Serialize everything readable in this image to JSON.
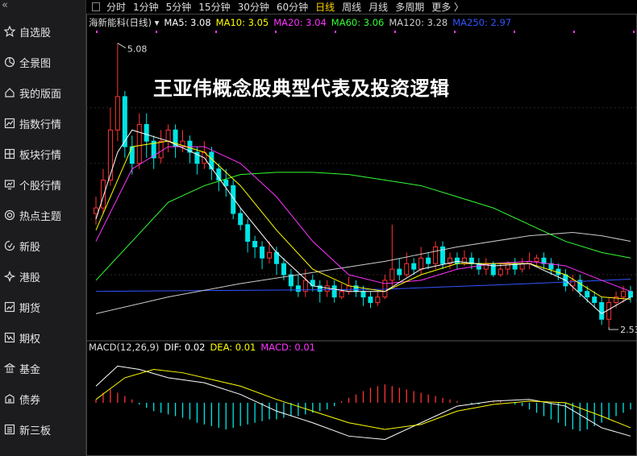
{
  "sidebar": {
    "collapse_glyph": "«",
    "items": [
      {
        "label": "自选股",
        "icon": "star-icon"
      },
      {
        "label": "全景图",
        "icon": "pie-icon"
      },
      {
        "label": "我的版面",
        "icon": "home-icon"
      },
      {
        "label": "指数行情",
        "icon": "chart-icon"
      },
      {
        "label": "板块行情",
        "icon": "blocks-icon"
      },
      {
        "label": "个股行情",
        "icon": "monitor-icon"
      },
      {
        "label": "热点主题",
        "icon": "target-icon"
      },
      {
        "label": "新股",
        "icon": "new-icon"
      },
      {
        "label": "港股",
        "icon": "hk-icon"
      },
      {
        "label": "期货",
        "icon": "futures-icon"
      },
      {
        "label": "期权",
        "icon": "options-icon"
      },
      {
        "label": "基金",
        "icon": "fund-icon"
      },
      {
        "label": "债券",
        "icon": "bond-icon"
      },
      {
        "label": "新三板",
        "icon": "nse-icon"
      }
    ]
  },
  "timeframes": [
    "分时",
    "1分钟",
    "5分钟",
    "15分钟",
    "30分钟",
    "60分钟",
    "日线",
    "周线",
    "月线",
    "多周期",
    "更多 〉"
  ],
  "active_timeframe": "日线",
  "ma_legend": [
    {
      "text": "海新能科(日线) ▾",
      "color": "#dddddd"
    },
    {
      "text": "MA5: 3.08",
      "color": "#ffffff"
    },
    {
      "text": "MA10: 3.05",
      "color": "#ffff00"
    },
    {
      "text": "MA20: 3.04",
      "color": "#ff33ff"
    },
    {
      "text": "MA60: 3.06",
      "color": "#33ff33"
    },
    {
      "text": "MA120: 3.28",
      "color": "#cccccc"
    },
    {
      "text": "MA250: 2.97",
      "color": "#3355ff"
    }
  ],
  "macd_legend": [
    {
      "text": "MACD(12,26,9)",
      "color": "#dddddd"
    },
    {
      "text": "DIF: 0.02",
      "color": "#ffffff"
    },
    {
      "text": "DEA: 0.01",
      "color": "#ffff00"
    },
    {
      "text": "MACD: 0.01",
      "color": "#ff33ff"
    }
  ],
  "headline": "王亚伟概念股典型代表及投资逻辑",
  "colors": {
    "up": "#ff3333",
    "down": "#00e5e5",
    "ma5": "#ffffff",
    "ma10": "#ffff00",
    "ma20": "#ff33ff",
    "ma60": "#33ff33",
    "ma120": "#cccccc",
    "ma250": "#3355ff"
  },
  "chart_data": {
    "type": "candlestick",
    "high_label": "5.08",
    "low_label": "2.53",
    "price_range": [
      2.45,
      5.2
    ],
    "candles": [
      [
        3.55,
        3.6,
        3.45,
        3.7
      ],
      [
        3.6,
        3.85,
        3.55,
        3.95
      ],
      [
        3.85,
        4.3,
        3.8,
        4.5
      ],
      [
        4.3,
        4.6,
        4.2,
        5.08
      ],
      [
        4.6,
        4.15,
        4.05,
        4.65
      ],
      [
        4.15,
        4.0,
        3.9,
        4.25
      ],
      [
        4.0,
        4.35,
        3.95,
        4.45
      ],
      [
        4.35,
        4.2,
        4.05,
        4.45
      ],
      [
        4.2,
        4.05,
        3.95,
        4.25
      ],
      [
        4.05,
        4.2,
        4.0,
        4.3
      ],
      [
        4.2,
        4.3,
        4.1,
        4.35
      ],
      [
        4.3,
        4.15,
        4.05,
        4.35
      ],
      [
        4.15,
        4.2,
        4.1,
        4.3
      ],
      [
        4.2,
        4.1,
        4.0,
        4.25
      ],
      [
        4.1,
        4.0,
        3.9,
        4.15
      ],
      [
        4.0,
        4.1,
        3.95,
        4.2
      ],
      [
        4.1,
        3.95,
        3.85,
        4.15
      ],
      [
        3.95,
        3.85,
        3.75,
        4.0
      ],
      [
        3.85,
        3.8,
        3.7,
        3.95
      ],
      [
        3.8,
        3.55,
        3.5,
        3.85
      ],
      [
        3.55,
        3.45,
        3.4,
        3.6
      ],
      [
        3.45,
        3.3,
        3.2,
        3.5
      ],
      [
        3.3,
        3.25,
        3.15,
        3.35
      ],
      [
        3.25,
        3.15,
        3.05,
        3.3
      ],
      [
        3.15,
        3.2,
        3.1,
        3.3
      ],
      [
        3.2,
        3.1,
        3.0,
        3.25
      ],
      [
        3.1,
        3.0,
        2.95,
        3.15
      ],
      [
        3.0,
        2.9,
        2.85,
        3.05
      ],
      [
        2.9,
        2.85,
        2.8,
        3.0
      ],
      [
        2.85,
        2.95,
        2.8,
        3.05
      ],
      [
        2.95,
        2.9,
        2.85,
        3.0
      ],
      [
        2.9,
        2.85,
        2.75,
        2.95
      ],
      [
        2.85,
        2.9,
        2.8,
        2.95
      ],
      [
        2.9,
        2.8,
        2.75,
        2.95
      ],
      [
        2.8,
        2.85,
        2.78,
        2.92
      ],
      [
        2.85,
        2.9,
        2.82,
        2.98
      ],
      [
        2.9,
        2.85,
        2.8,
        2.95
      ],
      [
        2.85,
        2.8,
        2.72,
        2.9
      ],
      [
        2.8,
        2.75,
        2.7,
        2.85
      ],
      [
        2.75,
        2.8,
        2.72,
        2.85
      ],
      [
        2.8,
        2.95,
        2.78,
        3.0
      ],
      [
        2.95,
        3.05,
        2.9,
        3.45
      ],
      [
        3.05,
        3.0,
        2.95,
        3.15
      ],
      [
        3.0,
        3.1,
        2.98,
        3.2
      ],
      [
        3.1,
        3.05,
        3.0,
        3.15
      ],
      [
        3.05,
        3.15,
        3.0,
        3.25
      ],
      [
        3.15,
        3.1,
        3.05,
        3.2
      ],
      [
        3.1,
        3.25,
        3.05,
        3.3
      ],
      [
        3.25,
        3.1,
        3.05,
        3.3
      ],
      [
        3.1,
        3.15,
        3.05,
        3.2
      ],
      [
        3.15,
        3.1,
        3.05,
        3.2
      ],
      [
        3.1,
        3.15,
        3.08,
        3.22
      ],
      [
        3.15,
        3.1,
        3.05,
        3.2
      ],
      [
        3.1,
        3.05,
        3.0,
        3.15
      ],
      [
        3.05,
        3.1,
        3.0,
        3.15
      ],
      [
        3.1,
        3.0,
        2.98,
        3.12
      ],
      [
        3.0,
        3.05,
        2.98,
        3.1
      ],
      [
        3.05,
        3.1,
        3.0,
        3.12
      ],
      [
        3.1,
        3.05,
        3.0,
        3.15
      ],
      [
        3.05,
        3.1,
        3.02,
        3.15
      ],
      [
        3.1,
        3.12,
        3.05,
        3.2
      ],
      [
        3.12,
        3.15,
        3.08,
        3.18
      ],
      [
        3.15,
        3.1,
        3.05,
        3.2
      ],
      [
        3.1,
        3.05,
        3.0,
        3.15
      ],
      [
        3.05,
        3.0,
        2.95,
        3.1
      ],
      [
        3.0,
        2.9,
        2.85,
        3.05
      ],
      [
        2.9,
        2.95,
        2.85,
        3.0
      ],
      [
        2.95,
        2.85,
        2.8,
        3.0
      ],
      [
        2.85,
        2.8,
        2.75,
        2.9
      ],
      [
        2.8,
        2.75,
        2.7,
        2.85
      ],
      [
        2.75,
        2.6,
        2.55,
        2.8
      ],
      [
        2.6,
        2.75,
        2.53,
        2.8
      ],
      [
        2.75,
        2.8,
        2.7,
        2.85
      ],
      [
        2.8,
        2.85,
        2.75,
        2.9
      ],
      [
        2.85,
        2.8,
        2.75,
        2.9
      ]
    ],
    "ma_series": {
      "ma5": [
        [
          0,
          3.5
        ],
        [
          3,
          4.1
        ],
        [
          5,
          4.3
        ],
        [
          10,
          4.2
        ],
        [
          15,
          4.05
        ],
        [
          20,
          3.6
        ],
        [
          25,
          3.2
        ],
        [
          30,
          2.9
        ],
        [
          35,
          2.85
        ],
        [
          40,
          2.85
        ],
        [
          45,
          3.05
        ],
        [
          50,
          3.12
        ],
        [
          55,
          3.08
        ],
        [
          60,
          3.1
        ],
        [
          65,
          2.95
        ],
        [
          70,
          2.65
        ],
        [
          74,
          2.8
        ]
      ],
      "ma10": [
        [
          0,
          3.4
        ],
        [
          5,
          4.15
        ],
        [
          10,
          4.2
        ],
        [
          15,
          4.1
        ],
        [
          20,
          3.8
        ],
        [
          25,
          3.4
        ],
        [
          30,
          3.05
        ],
        [
          35,
          2.9
        ],
        [
          40,
          2.85
        ],
        [
          45,
          3.0
        ],
        [
          50,
          3.1
        ],
        [
          55,
          3.1
        ],
        [
          60,
          3.1
        ],
        [
          65,
          3.0
        ],
        [
          70,
          2.8
        ],
        [
          74,
          2.78
        ]
      ],
      "ma20": [
        [
          0,
          3.3
        ],
        [
          5,
          3.95
        ],
        [
          10,
          4.15
        ],
        [
          15,
          4.15
        ],
        [
          20,
          4.0
        ],
        [
          25,
          3.7
        ],
        [
          30,
          3.3
        ],
        [
          35,
          3.0
        ],
        [
          40,
          2.92
        ],
        [
          45,
          2.95
        ],
        [
          50,
          3.05
        ],
        [
          55,
          3.1
        ],
        [
          60,
          3.12
        ],
        [
          65,
          3.08
        ],
        [
          70,
          2.95
        ],
        [
          74,
          2.85
        ]
      ],
      "ma60": [
        [
          0,
          2.95
        ],
        [
          5,
          3.3
        ],
        [
          10,
          3.65
        ],
        [
          15,
          3.8
        ],
        [
          20,
          3.9
        ],
        [
          25,
          3.92
        ],
        [
          30,
          3.92
        ],
        [
          35,
          3.9
        ],
        [
          40,
          3.85
        ],
        [
          45,
          3.8
        ],
        [
          50,
          3.7
        ],
        [
          55,
          3.6
        ],
        [
          60,
          3.45
        ],
        [
          65,
          3.3
        ],
        [
          70,
          3.2
        ],
        [
          74,
          3.15
        ]
      ],
      "ma120": [
        [
          0,
          2.65
        ],
        [
          10,
          2.8
        ],
        [
          20,
          2.92
        ],
        [
          30,
          3.02
        ],
        [
          40,
          3.12
        ],
        [
          50,
          3.25
        ],
        [
          60,
          3.35
        ],
        [
          66,
          3.38
        ],
        [
          70,
          3.35
        ],
        [
          74,
          3.3
        ]
      ],
      "ma250": [
        [
          0,
          2.85
        ],
        [
          20,
          2.86
        ],
        [
          40,
          2.87
        ],
        [
          60,
          2.92
        ],
        [
          74,
          2.96
        ]
      ]
    },
    "macd": {
      "range": [
        -0.3,
        0.28
      ],
      "dif": [
        [
          0,
          0.1
        ],
        [
          3,
          0.22
        ],
        [
          6,
          0.2
        ],
        [
          10,
          0.15
        ],
        [
          15,
          0.12
        ],
        [
          20,
          0.05
        ],
        [
          25,
          -0.05
        ],
        [
          30,
          -0.12
        ],
        [
          35,
          -0.2
        ],
        [
          40,
          -0.22
        ],
        [
          45,
          -0.12
        ],
        [
          50,
          -0.02
        ],
        [
          55,
          0.01
        ],
        [
          60,
          0.02
        ],
        [
          65,
          -0.02
        ],
        [
          70,
          -0.15
        ],
        [
          74,
          -0.2
        ]
      ],
      "dea": [
        [
          0,
          0.02
        ],
        [
          4,
          0.15
        ],
        [
          8,
          0.2
        ],
        [
          12,
          0.18
        ],
        [
          16,
          0.14
        ],
        [
          20,
          0.1
        ],
        [
          25,
          0.02
        ],
        [
          30,
          -0.05
        ],
        [
          35,
          -0.12
        ],
        [
          40,
          -0.16
        ],
        [
          45,
          -0.13
        ],
        [
          50,
          -0.05
        ],
        [
          55,
          -0.01
        ],
        [
          60,
          0.01
        ],
        [
          65,
          0.0
        ],
        [
          70,
          -0.08
        ],
        [
          74,
          -0.15
        ]
      ],
      "bars": [
        0.02,
        0.06,
        0.08,
        0.06,
        0.04,
        0.02,
        -0.01,
        -0.03,
        -0.05,
        -0.06,
        -0.07,
        -0.08,
        -0.09,
        -0.1,
        -0.12,
        -0.13,
        -0.14,
        -0.15,
        -0.16,
        -0.15,
        -0.14,
        -0.13,
        -0.12,
        -0.11,
        -0.1,
        -0.1,
        -0.09,
        -0.08,
        -0.08,
        -0.07,
        -0.06,
        -0.05,
        -0.04,
        -0.02,
        0.01,
        0.03,
        0.05,
        0.07,
        0.09,
        0.1,
        0.11,
        0.1,
        0.09,
        0.08,
        0.07,
        0.06,
        0.05,
        0.04,
        0.03,
        0.02,
        0.01,
        0.0,
        -0.01,
        -0.01,
        0.0,
        0.01,
        0.01,
        0.0,
        -0.01,
        -0.02,
        -0.04,
        -0.06,
        -0.08,
        -0.1,
        -0.12,
        -0.14,
        -0.16,
        -0.17,
        -0.16,
        -0.14,
        -0.12,
        -0.1,
        -0.08,
        -0.06,
        -0.04
      ]
    }
  }
}
